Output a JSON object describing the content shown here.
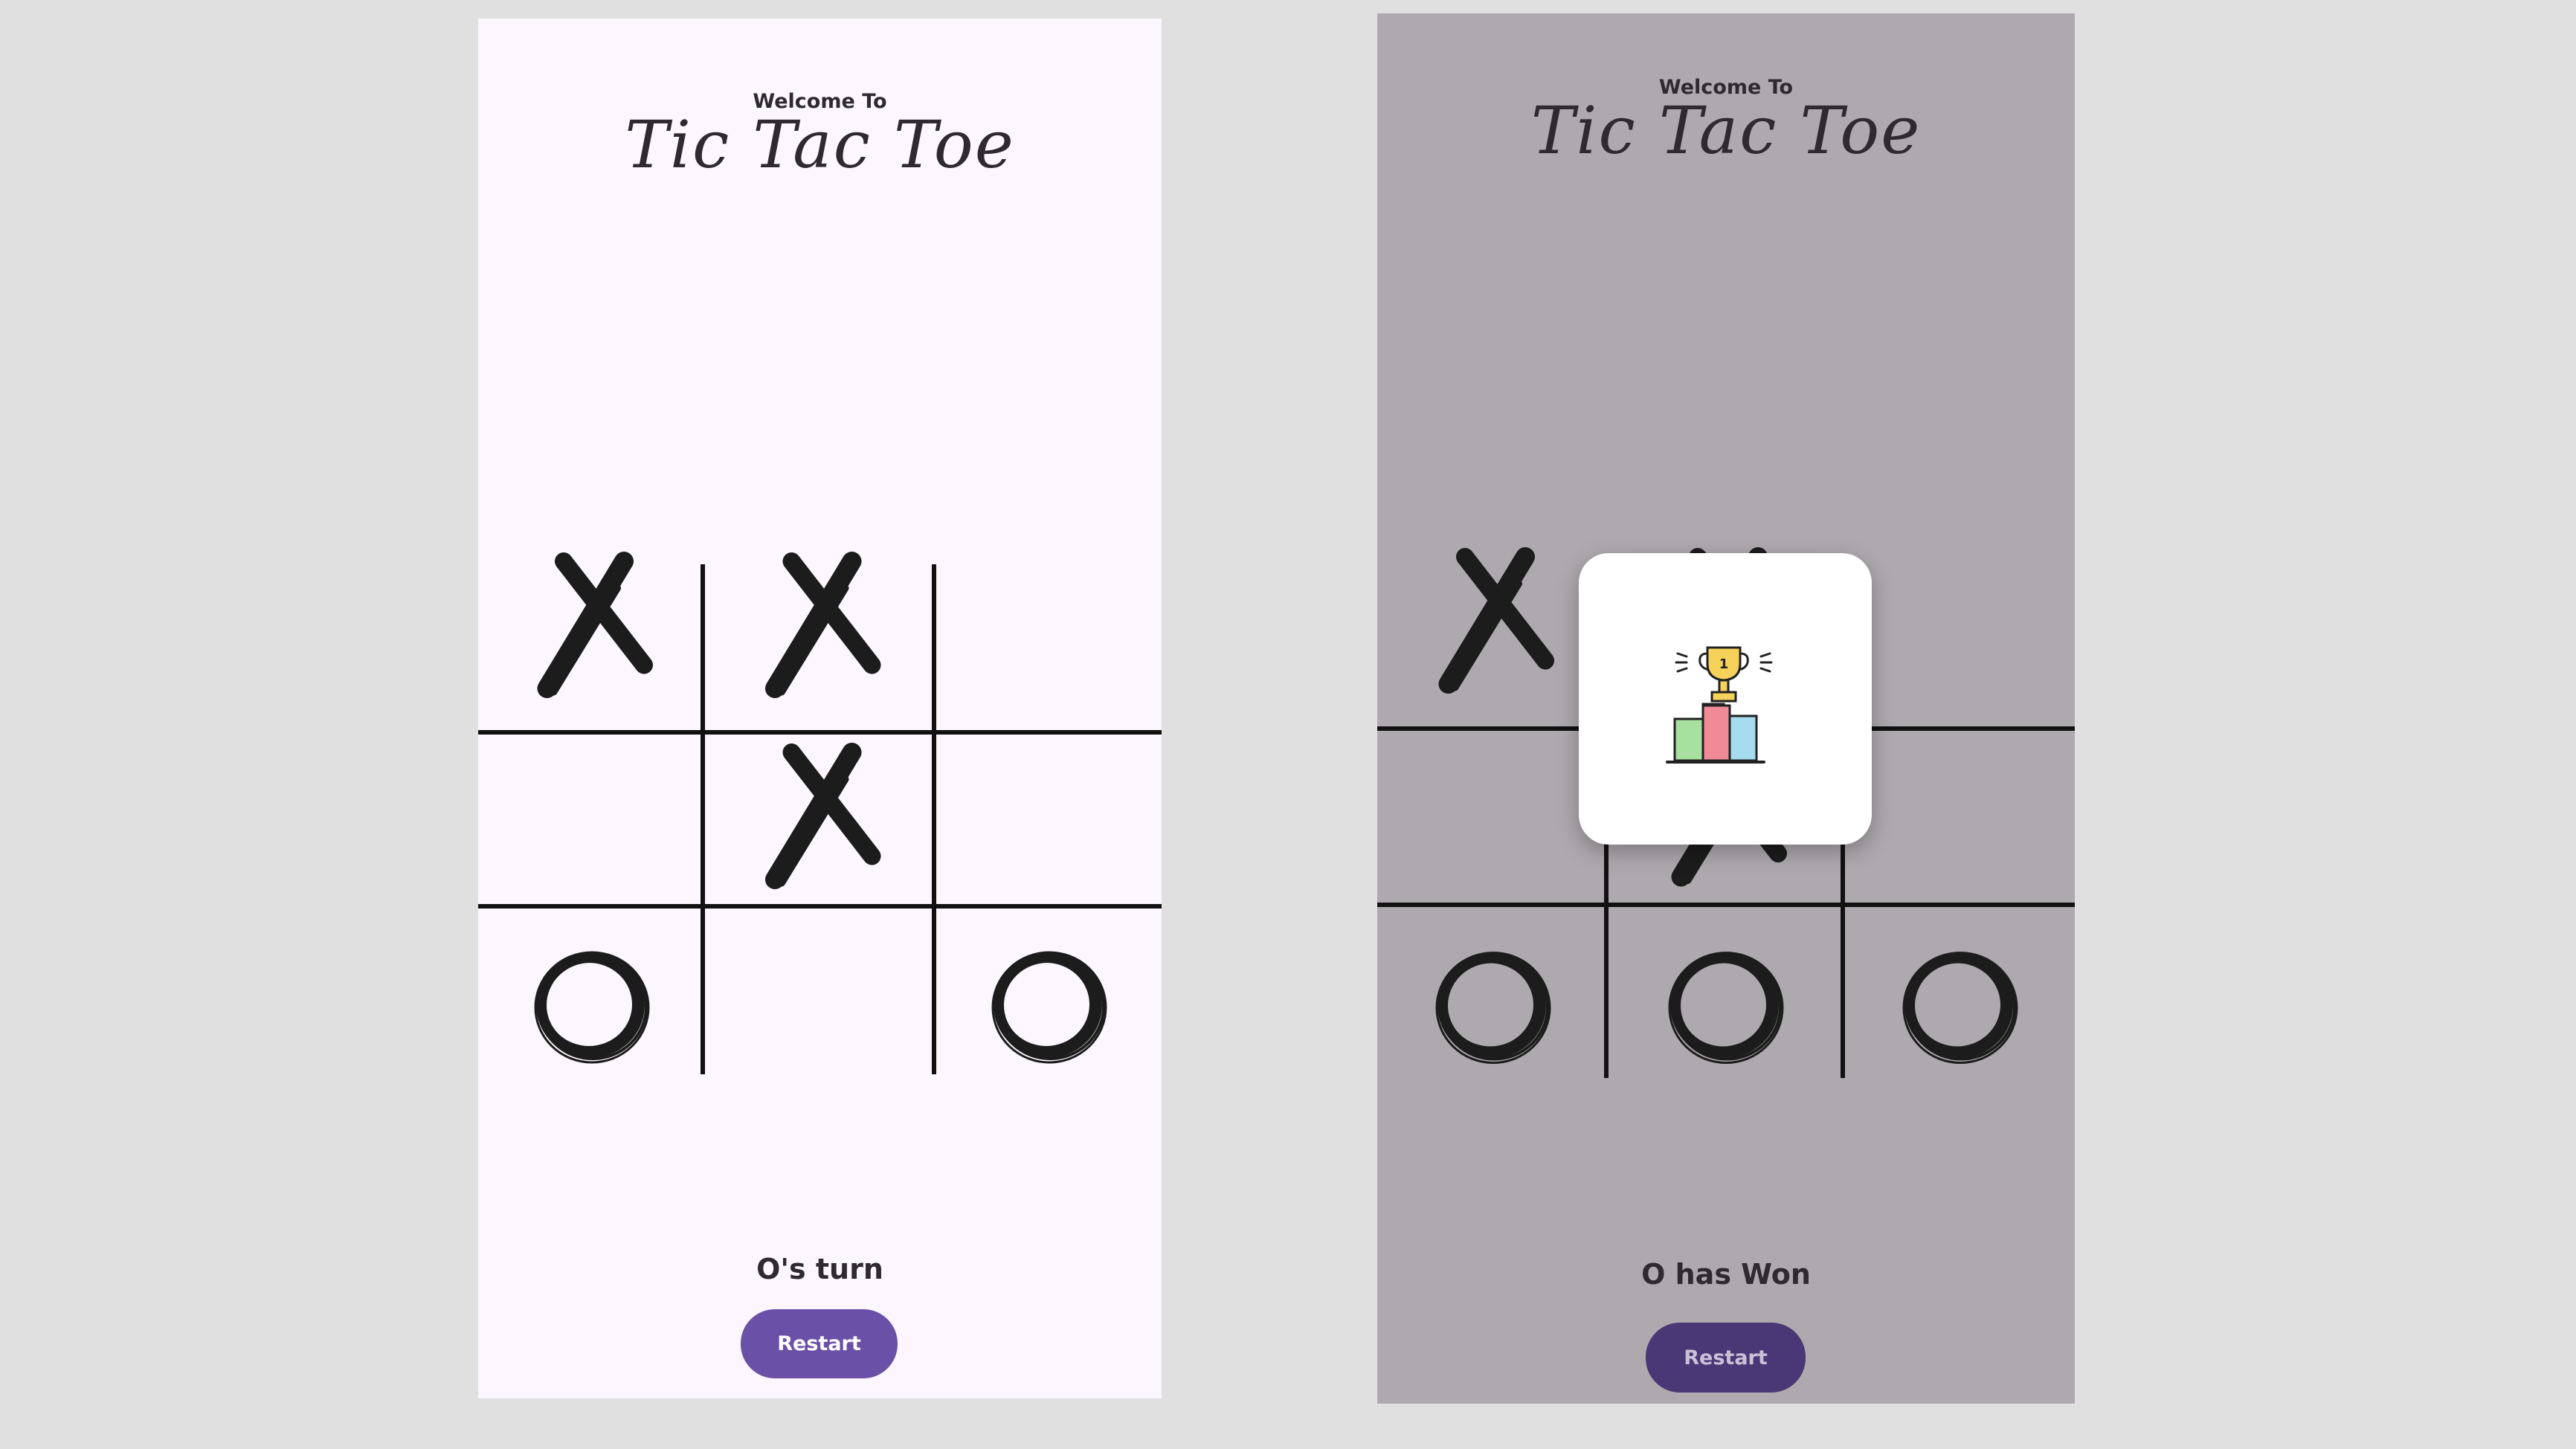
{
  "screens": [
    {
      "welcome": "Welcome To",
      "title": "Tic Tac Toe",
      "board": [
        "X",
        "X",
        "",
        "",
        "X",
        "",
        "O",
        "",
        "O"
      ],
      "status": "O's turn",
      "restart_label": "Restart",
      "background": "#fcf6fe"
    },
    {
      "welcome": "Welcome To",
      "title": "Tic Tac Toe",
      "board": [
        "X",
        "X",
        "",
        "",
        "X",
        "",
        "O",
        "O",
        "O"
      ],
      "status": "O has Won",
      "restart_label": "Restart",
      "background": "#aea9ae",
      "dialog": {
        "icon": "trophy-podium-icon",
        "visible": true
      }
    }
  ],
  "colors": {
    "accent": "#6b50a8",
    "accent_dim": "#4a3776",
    "text": "#2f2a2f",
    "dim_overlay": "#aea9ae"
  }
}
